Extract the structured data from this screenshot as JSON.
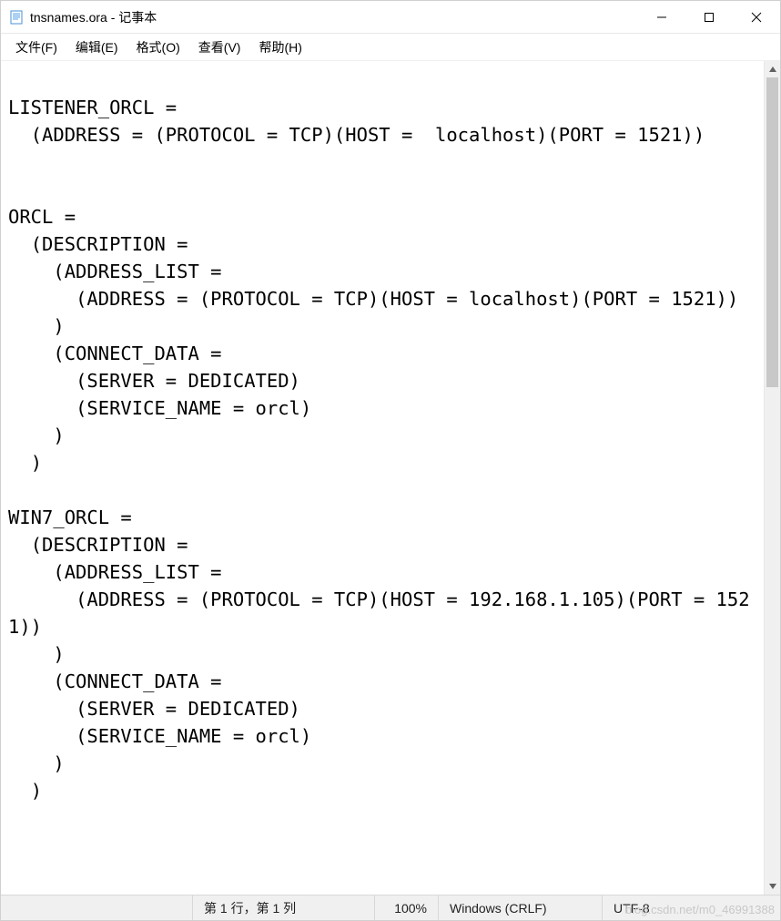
{
  "titlebar": {
    "title": "tnsnames.ora - 记事本"
  },
  "menubar": {
    "items": [
      {
        "label": "文件(F)"
      },
      {
        "label": "编辑(E)"
      },
      {
        "label": "格式(O)"
      },
      {
        "label": "查看(V)"
      },
      {
        "label": "帮助(H)"
      }
    ]
  },
  "editor": {
    "content": "\nLISTENER_ORCL =\n  (ADDRESS = (PROTOCOL = TCP)(HOST =  localhost)(PORT = 1521))\n\n\nORCL =\n  (DESCRIPTION =\n    (ADDRESS_LIST =\n      (ADDRESS = (PROTOCOL = TCP)(HOST = localhost)(PORT = 1521))\n    )\n    (CONNECT_DATA =\n      (SERVER = DEDICATED)\n      (SERVICE_NAME = orcl)\n    )\n  )\n\nWIN7_ORCL =\n  (DESCRIPTION =\n    (ADDRESS_LIST =\n      (ADDRESS = (PROTOCOL = TCP)(HOST = 192.168.1.105)(PORT = 1521))\n    )\n    (CONNECT_DATA =\n      (SERVER = DEDICATED)\n      (SERVICE_NAME = orcl)\n    )\n  )\n"
  },
  "statusbar": {
    "position": "第 1 行，第 1 列",
    "zoom": "100%",
    "eol": "Windows (CRLF)",
    "encoding": "UTF-8",
    "watermark": "blog.csdn.net/m0_46991388"
  }
}
